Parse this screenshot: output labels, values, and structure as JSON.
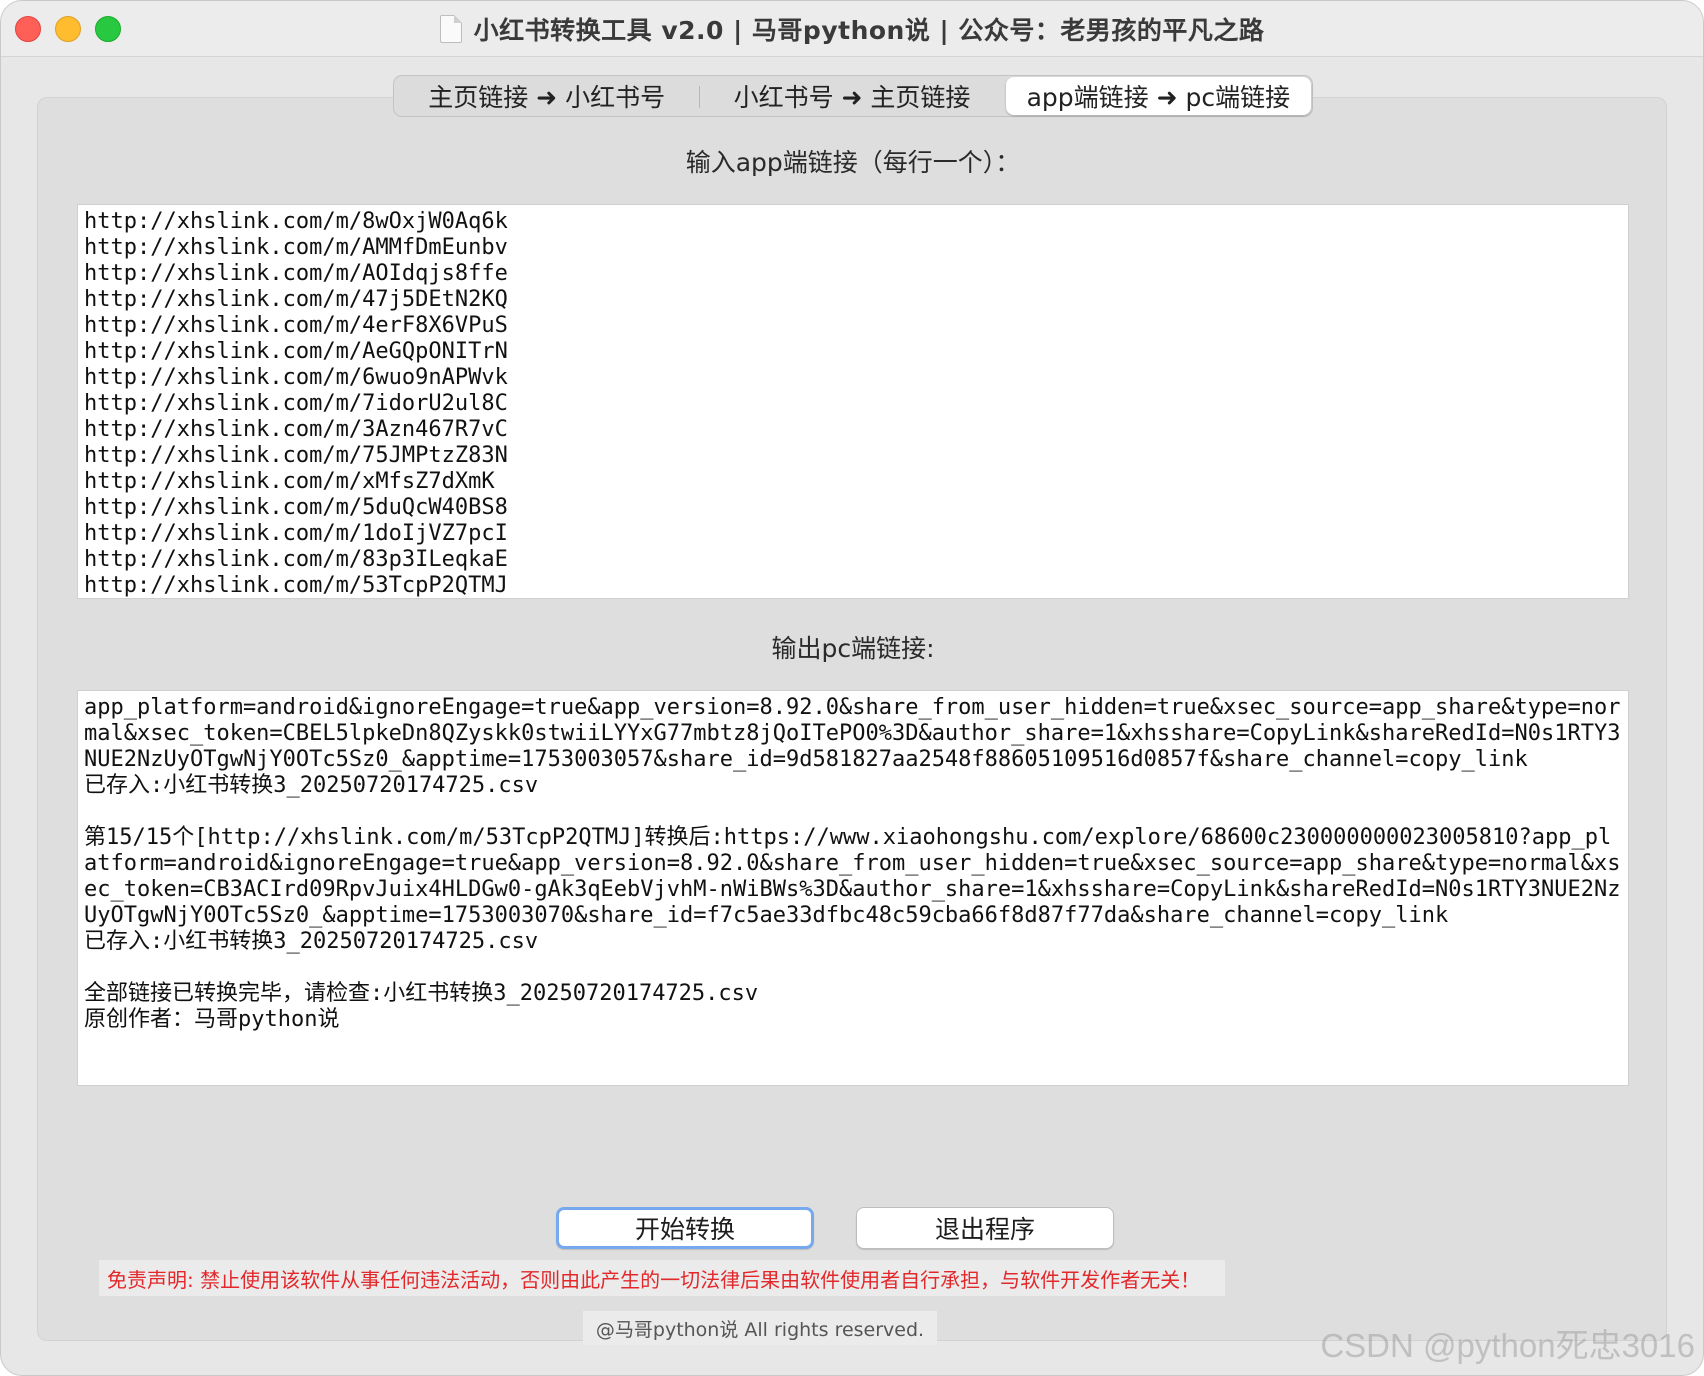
{
  "window": {
    "title": "小红书转换工具 v2.0 | 马哥python说 | 公众号：老男孩的平凡之路"
  },
  "tabs": [
    {
      "label": "主页链接 ➜ 小红书号",
      "active": false
    },
    {
      "label": "小红书号 ➜ 主页链接",
      "active": false
    },
    {
      "label": "app端链接 ➜ pc端链接",
      "active": true
    }
  ],
  "input": {
    "label": "输入app端链接（每行一个）：",
    "lines": [
      "http://xhslink.com/m/8wOxjW0Aq6k",
      "http://xhslink.com/m/AMMfDmEunbv",
      "http://xhslink.com/m/AOIdqjs8ffe",
      "http://xhslink.com/m/47j5DEtN2KQ",
      "http://xhslink.com/m/4erF8X6VPuS",
      "http://xhslink.com/m/AeGQpONITrN",
      "http://xhslink.com/m/6wuo9nAPWvk",
      "http://xhslink.com/m/7idorU2ul8C",
      "http://xhslink.com/m/3Azn467R7vC",
      "http://xhslink.com/m/75JMPtzZ83N",
      "http://xhslink.com/m/xMfsZ7dXmK",
      "http://xhslink.com/m/5duQcW40BS8",
      "http://xhslink.com/m/1doIjVZ7pcI",
      "http://xhslink.com/m/83p3ILeqkaE",
      "http://xhslink.com/m/53TcpP2QTMJ"
    ]
  },
  "output": {
    "label": "输出pc端链接:",
    "lines": [
      "app_platform=android&ignoreEngage=true&app_version=8.92.0&share_from_user_hidden=true&xsec_source=app_share&type=normal&xsec_token=CBEL5lpkeDn8QZyskk0stwiiLYYxG77mbtz8jQoITePO0%3D&author_share=1&xhsshare=CopyLink&shareRedId=N0s1RTY3NUE2NzUyOTgwNjY0OTc5Sz0_&apptime=1753003057&share_id=9d581827aa2548f88605109516d0857f&share_channel=copy_link",
      "已存入:小红书转换3_20250720174725.csv",
      "",
      "第15/15个[http://xhslink.com/m/53TcpP2QTMJ]转换后:https://www.xiaohongshu.com/explore/68600c230000000023005810?app_platform=android&ignoreEngage=true&app_version=8.92.0&share_from_user_hidden=true&xsec_source=app_share&type=normal&xsec_token=CB3ACIrd09RpvJuix4HLDGw0-gAk3qEebVjvhM-nWiBWs%3D&author_share=1&xhsshare=CopyLink&shareRedId=N0s1RTY3NUE2NzUyOTgwNjY0OTc5Sz0_&apptime=1753003070&share_id=f7c5ae33dfbc48c59cba66f8d87f77da&share_channel=copy_link",
      "已存入:小红书转换3_20250720174725.csv",
      "",
      "全部链接已转换完毕，请检查:小红书转换3_20250720174725.csv",
      "原创作者：马哥python说"
    ]
  },
  "buttons": {
    "start": "开始转换",
    "exit": "退出程序"
  },
  "disclaimer": "免责声明: 禁止使用该软件从事任何违法活动，否则由此产生的一切法律后果由软件使用者自行承担，与软件开发作者无关！",
  "footer": "@马哥python说 All rights reserved.",
  "watermark": "CSDN @python死忠3016",
  "colors": {
    "disclaimer_text": "#e3282b",
    "primary_button_ring": "#77a9ef",
    "traffic_close": "#fe5f57",
    "traffic_minimize": "#febc2e",
    "traffic_maximize": "#28c840"
  }
}
